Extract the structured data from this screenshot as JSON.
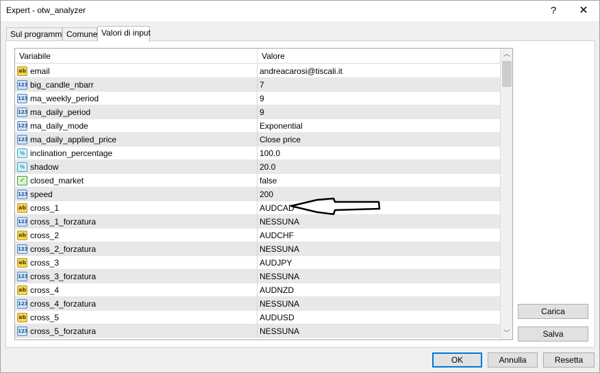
{
  "window": {
    "title": "Expert - otw_analyzer",
    "help_glyph": "?",
    "close_glyph": "✕"
  },
  "tabs": [
    {
      "label": "Sul programma",
      "active": false
    },
    {
      "label": "Comune",
      "active": false
    },
    {
      "label": "Valori di input",
      "active": true
    }
  ],
  "grid": {
    "headers": {
      "variable": "Variabile",
      "value": "Valore"
    },
    "rows": [
      {
        "icon": "ab",
        "icon_name": "string-type-icon",
        "name": "email",
        "value": "andreacarosi@tiscali.it"
      },
      {
        "icon": "123",
        "icon_name": "integer-type-icon",
        "name": "big_candle_nbarr",
        "value": "7"
      },
      {
        "icon": "123",
        "icon_name": "integer-type-icon",
        "name": "ma_weekly_period",
        "value": "9"
      },
      {
        "icon": "123",
        "icon_name": "integer-type-icon",
        "name": "ma_daily_period",
        "value": "9"
      },
      {
        "icon": "123",
        "icon_name": "enum-type-icon",
        "name": "ma_daily_mode",
        "value": "Exponential"
      },
      {
        "icon": "123",
        "icon_name": "enum-type-icon",
        "name": "ma_daily_applied_price",
        "value": "Close price"
      },
      {
        "icon": "½",
        "icon_name": "double-type-icon",
        "name": "inclination_percentage",
        "value": "100.0"
      },
      {
        "icon": "½",
        "icon_name": "double-type-icon",
        "name": "shadow",
        "value": "20.0"
      },
      {
        "icon": "✓",
        "icon_name": "bool-type-icon",
        "name": "closed_market",
        "value": "false"
      },
      {
        "icon": "123",
        "icon_name": "integer-type-icon",
        "name": "speed",
        "value": "200"
      },
      {
        "icon": "ab",
        "icon_name": "string-type-icon",
        "name": "cross_1",
        "value": "AUDCAD"
      },
      {
        "icon": "123",
        "icon_name": "enum-type-icon",
        "name": "cross_1_forzatura",
        "value": "NESSUNA"
      },
      {
        "icon": "ab",
        "icon_name": "string-type-icon",
        "name": "cross_2",
        "value": "AUDCHF"
      },
      {
        "icon": "123",
        "icon_name": "enum-type-icon",
        "name": "cross_2_forzatura",
        "value": "NESSUNA"
      },
      {
        "icon": "ab",
        "icon_name": "string-type-icon",
        "name": "cross_3",
        "value": "AUDJPY"
      },
      {
        "icon": "123",
        "icon_name": "enum-type-icon",
        "name": "cross_3_forzatura",
        "value": "NESSUNA"
      },
      {
        "icon": "ab",
        "icon_name": "string-type-icon",
        "name": "cross_4",
        "value": "AUDNZD"
      },
      {
        "icon": "123",
        "icon_name": "enum-type-icon",
        "name": "cross_4_forzatura",
        "value": "NESSUNA"
      },
      {
        "icon": "ab",
        "icon_name": "string-type-icon",
        "name": "cross_5",
        "value": "AUDUSD"
      },
      {
        "icon": "123",
        "icon_name": "enum-type-icon",
        "name": "cross_5_forzatura",
        "value": "NESSUNA"
      }
    ]
  },
  "scrollbar": {
    "up_glyph": "︿",
    "down_glyph": "﹀"
  },
  "side_buttons": {
    "load": "Carica",
    "save": "Salva"
  },
  "bottom_buttons": {
    "ok": "OK",
    "cancel": "Annulla",
    "reset": "Resetta"
  },
  "annotation": {
    "type": "hand-drawn-arrow",
    "points_to": "shadow"
  }
}
